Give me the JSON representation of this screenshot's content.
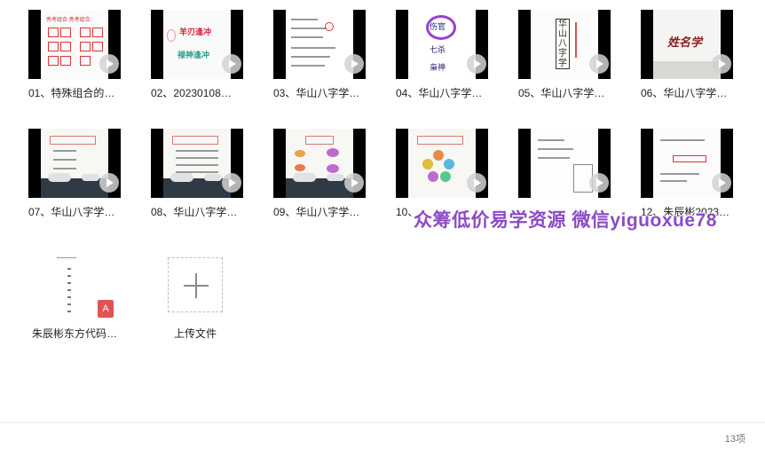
{
  "files": [
    {
      "name": "01、特殊组合的…"
    },
    {
      "name": "02、20230108…"
    },
    {
      "name": "03、华山八字学…"
    },
    {
      "name": "04、华山八字学…"
    },
    {
      "name": "05、华山八字学…"
    },
    {
      "name": "06、华山八字学…"
    },
    {
      "name": "07、华山八字学…"
    },
    {
      "name": "08、华山八字学…"
    },
    {
      "name": "09、华山八字学…"
    },
    {
      "name": "10、…"
    },
    {
      "name": "…"
    },
    {
      "name": "12、朱辰彬2023…"
    },
    {
      "name": "朱辰彬东方代码…"
    }
  ],
  "upload_label": "上传文件",
  "watermark": "众筹低价易学资源 微信yiguoxue78",
  "item_count": "13项",
  "thumb_text": {
    "t1_title": "亮考组合 亮考组合",
    "t2_line1": "羊刃逢冲",
    "t2_line2": "禄神逢冲",
    "t4_top": "伤官",
    "t4_mid": "七杀",
    "t4_bot": "枭神",
    "t5_vertical": "华山八字学",
    "t6_title": "姓名学",
    "pdf_badge": "A"
  },
  "colors": {
    "watermark": "#8b4bc7",
    "pdf_red": "#e05454"
  }
}
